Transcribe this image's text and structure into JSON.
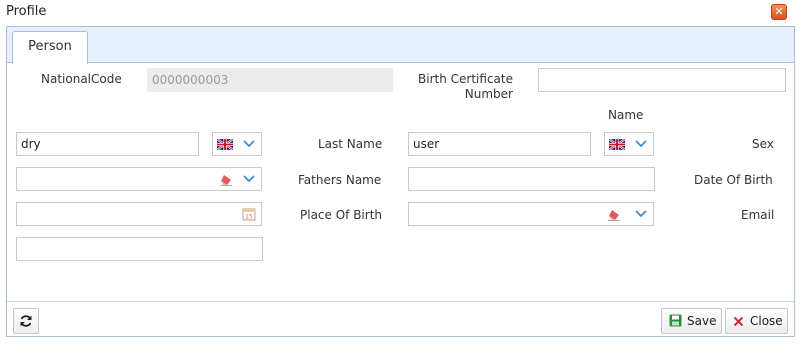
{
  "window": {
    "title": "Profile",
    "close_icon": "close-icon"
  },
  "tabs": [
    {
      "label": "Person"
    }
  ],
  "form": {
    "national_code": {
      "label": "NationalCode",
      "value": "0000000003"
    },
    "birth_certificate_number": {
      "label": "Birth Certificate Number",
      "value": ""
    },
    "name": {
      "label": "Name",
      "value": "dry",
      "language_flag": "uk-flag-icon"
    },
    "last_name": {
      "label": "Last Name",
      "value": "user",
      "language_flag": "uk-flag-icon"
    },
    "sex": {
      "label": "Sex",
      "value": ""
    },
    "fathers_name": {
      "label": "Fathers Name",
      "value": ""
    },
    "date_of_birth": {
      "label": "Date Of Birth",
      "value": ""
    },
    "place_of_birth": {
      "label": "Place Of Birth",
      "value": ""
    },
    "email": {
      "label": "Email",
      "value": ""
    }
  },
  "footer": {
    "refresh_icon": "refresh-icon",
    "save_label": "Save",
    "close_label": "Close"
  },
  "colors": {
    "tab_background": "#e7f0fa",
    "border": "#a8bfd9",
    "close_button": "#e0602a",
    "save_icon": "#2e8b3c",
    "close_icon": "#d22e2e",
    "chevron": "#3a8fd6"
  }
}
